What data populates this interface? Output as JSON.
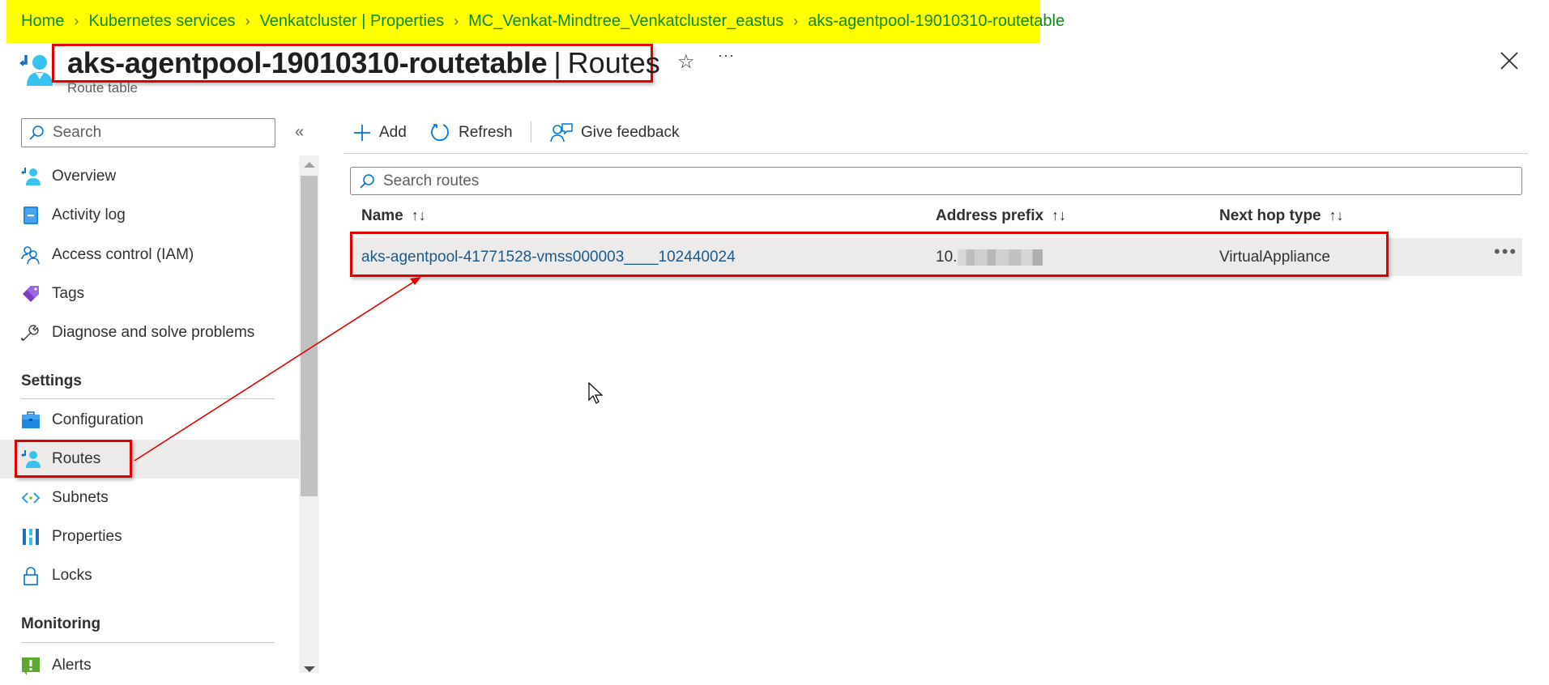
{
  "breadcrumb": [
    {
      "label": "Home"
    },
    {
      "label": "Kubernetes services"
    },
    {
      "label": "Venkatcluster | Properties"
    },
    {
      "label": "MC_Venkat-Mindtree_Venkatcluster_eastus"
    },
    {
      "label": "aks-agentpool-19010310-routetable"
    }
  ],
  "breadcrumb_separator": ">",
  "header": {
    "resource_name": "aks-agentpool-19010310-routetable",
    "pipe": "|",
    "page_name": "Routes",
    "subtitle": "Route table",
    "favorite_icon": "star-icon",
    "more_label": "···",
    "close_icon": "close-icon"
  },
  "sidebar": {
    "search_placeholder": "Search",
    "collapse_label": "«",
    "items": [
      {
        "label": "Overview",
        "icon": "route-table-icon"
      },
      {
        "label": "Activity log",
        "icon": "activity-log-icon"
      },
      {
        "label": "Access control (IAM)",
        "icon": "iam-icon"
      },
      {
        "label": "Tags",
        "icon": "tag-icon"
      },
      {
        "label": "Diagnose and solve problems",
        "icon": "wrench-icon"
      }
    ],
    "sections": [
      {
        "title": "Settings",
        "items": [
          {
            "label": "Configuration",
            "icon": "configuration-icon"
          },
          {
            "label": "Routes",
            "icon": "route-table-icon",
            "selected": true
          },
          {
            "label": "Subnets",
            "icon": "subnet-icon"
          },
          {
            "label": "Properties",
            "icon": "properties-icon"
          },
          {
            "label": "Locks",
            "icon": "lock-icon"
          }
        ]
      },
      {
        "title": "Monitoring",
        "items": [
          {
            "label": "Alerts",
            "icon": "alert-icon"
          }
        ]
      }
    ]
  },
  "toolbar": {
    "add_label": "Add",
    "refresh_label": "Refresh",
    "feedback_label": "Give feedback"
  },
  "routes": {
    "search_placeholder": "Search routes",
    "columns": [
      {
        "label": "Name",
        "sort": "↑↓"
      },
      {
        "label": "Address prefix",
        "sort": "↑↓"
      },
      {
        "label": "Next hop type",
        "sort": "↑↓"
      }
    ],
    "rows": [
      {
        "name": "aks-agentpool-41771528-vmss000003____102440024",
        "address_prefix": "10.",
        "address_prefix_redacted": true,
        "next_hop_type": "VirtualAppliance",
        "more_label": "•••"
      }
    ]
  },
  "colors": {
    "breadcrumb_highlight": "#ffff00",
    "breadcrumb_text": "#0e8a16",
    "annotation_red": "#e00000",
    "link_blue": "#1b5a8e",
    "accent_blue": "#0078d4",
    "selected_bg": "#edebe9"
  }
}
